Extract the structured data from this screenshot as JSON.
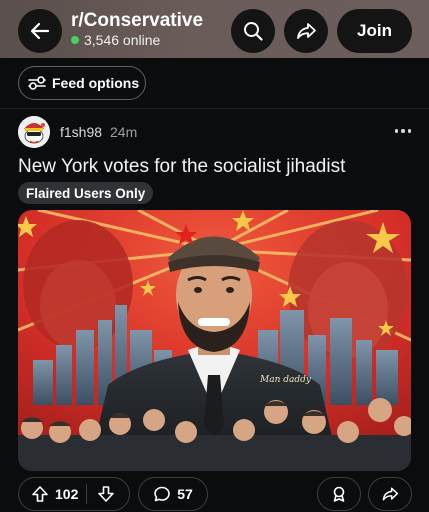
{
  "header": {
    "subreddit": "r/Conservative",
    "online": "3,546 online",
    "join_label": "Join"
  },
  "feed": {
    "options_label": "Feed options"
  },
  "post": {
    "username": "f1sh98",
    "age": "24m",
    "title": "New York votes for the socialist jihadist",
    "flair": "Flaired Users Only",
    "image_caption": "Man daddy",
    "upvotes": "102",
    "comments": "57"
  },
  "icons": {
    "back": "arrow-left-icon",
    "search": "search-icon",
    "share": "share-arrow-icon",
    "feed": "tune-icon",
    "more": "more-horizontal-icon",
    "upvote": "upvote-arrow-icon",
    "downvote": "downvote-arrow-icon",
    "comment": "comment-bubble-icon",
    "award": "award-icon"
  },
  "colors": {
    "background": "#0b0c0e",
    "header": "#5f5452",
    "online_dot": "#46d160",
    "poster_red": "#d8322a"
  }
}
